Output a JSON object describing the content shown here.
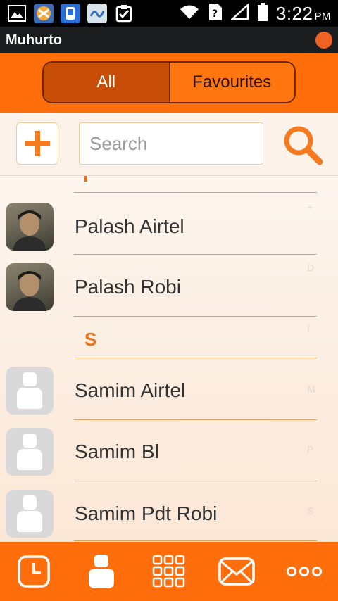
{
  "status_bar": {
    "time": "3:22",
    "ampm": "PM",
    "icons": [
      "image-icon",
      "sync-browser-icon",
      "app-store-icon",
      "gallery-icon",
      "clipboard-check-icon",
      "wifi-icon",
      "sim-unknown-icon",
      "signal-icon",
      "battery-icon"
    ]
  },
  "app": {
    "title": "Muhurto",
    "accent": "#ff6e0b"
  },
  "tabs": {
    "all": "All",
    "favourites": "Favourites",
    "selected": "All"
  },
  "search": {
    "placeholder": "Search"
  },
  "contacts": [
    {
      "name": "Palash Airtel",
      "avatar": "photo"
    },
    {
      "name": "Palash Robi",
      "avatar": "photo"
    },
    {
      "name": "Samim Airtel",
      "avatar": "placeholder"
    },
    {
      "name": "Samim Bl",
      "avatar": "placeholder"
    },
    {
      "name": "Samim Pdt Robi",
      "avatar": "placeholder"
    }
  ],
  "section_letter": "S",
  "index_letters": [
    "+",
    "D",
    "I",
    "M",
    "P",
    "S"
  ],
  "bottom_nav": [
    "recents-clock-icon",
    "contacts-person-icon",
    "dialpad-icon",
    "messages-envelope-icon",
    "more-icon"
  ]
}
